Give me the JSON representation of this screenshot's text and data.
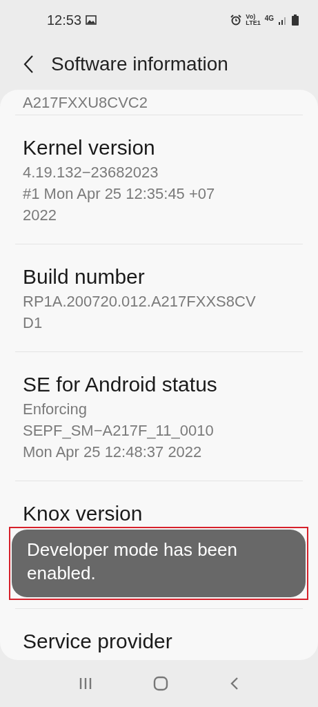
{
  "status_bar": {
    "time": "12:53",
    "volte_top": "Vo)",
    "volte_bottom": "LTE1",
    "network": "4G"
  },
  "header": {
    "title": "Software information"
  },
  "clipped_value": "A217FXXU8CVC2",
  "sections": [
    {
      "title": "Kernel version",
      "values": [
        "4.19.132−23682023",
        "#1 Mon Apr 25 12:35:45 +07",
        "2022"
      ]
    },
    {
      "title": "Build number",
      "values": [
        "RP1A.200720.012.A217FXXS8CV",
        "D1"
      ]
    },
    {
      "title": "SE for Android status",
      "values": [
        "Enforcing",
        "SEPF_SM−A217F_11_0010",
        "Mon Apr 25 12:48:37 2022"
      ]
    },
    {
      "title": "Knox version"
    },
    {
      "title": "Service provider"
    }
  ],
  "toast": {
    "text": "Developer mode has been enabled.",
    "highlighted": true
  }
}
